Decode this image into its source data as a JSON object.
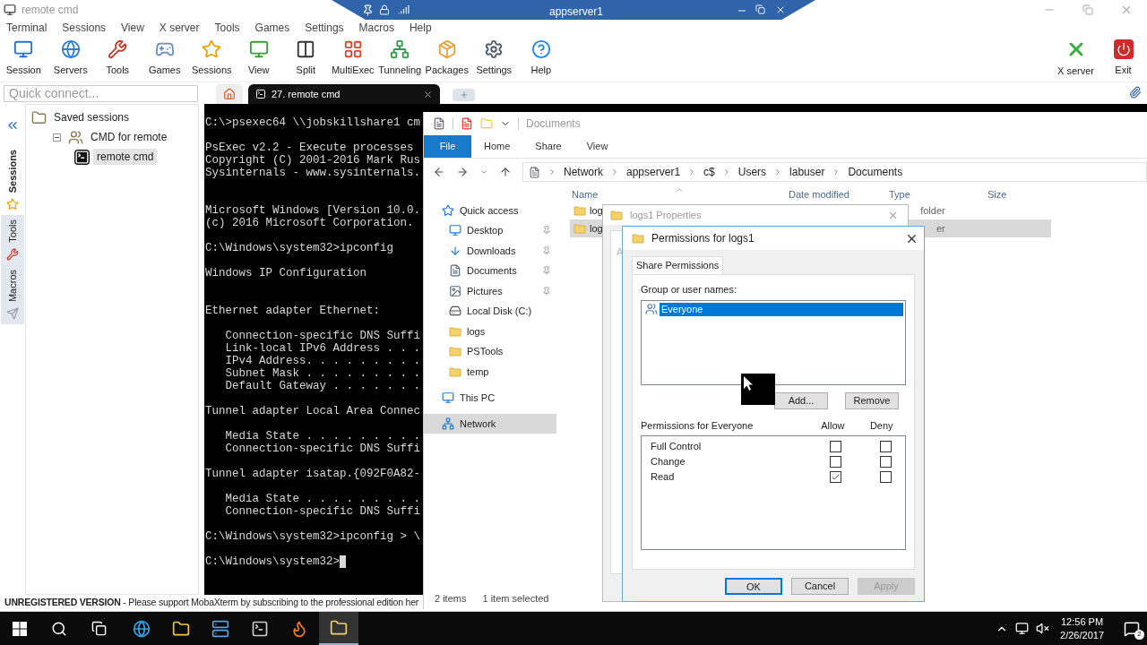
{
  "app": {
    "title": "remote cmd"
  },
  "remote_bar": {
    "title": "appserver1"
  },
  "menu": [
    "Terminal",
    "Sessions",
    "View",
    "X server",
    "Tools",
    "Games",
    "Settings",
    "Macros",
    "Help"
  ],
  "toolbar": [
    "Session",
    "Servers",
    "Tools",
    "Games",
    "Sessions",
    "View",
    "Split",
    "MultiExec",
    "Tunneling",
    "Packages",
    "Settings",
    "Help"
  ],
  "toolbar_right": [
    "X server",
    "Exit"
  ],
  "quick_connect": {
    "placeholder": "Quick connect..."
  },
  "tabs": [
    {
      "kind": "home",
      "selected": false
    },
    {
      "kind": "session",
      "label": "27. remote cmd",
      "selected": true
    },
    {
      "kind": "add",
      "selected": false
    }
  ],
  "side_tabs": [
    {
      "label": "Sessions",
      "selected": true
    },
    {
      "label": "Tools",
      "selected": false
    },
    {
      "label": "Macros",
      "selected": false
    }
  ],
  "session_tree": [
    {
      "label": "Saved sessions",
      "kind": "root",
      "selected": false,
      "children": [
        {
          "label": "CMD for remote",
          "kind": "folder",
          "expanded": true,
          "selected": false,
          "children": [
            {
              "label": "remote cmd",
              "kind": "session",
              "selected": true
            }
          ]
        }
      ]
    }
  ],
  "terminal": {
    "lines": [
      {
        "kind": "text",
        "text": "C:\\>psexec64 \\\\jobskillshare1 cm"
      },
      {
        "kind": "blank"
      },
      {
        "kind": "text",
        "text": "PsExec v2.2 - Execute processes"
      },
      {
        "kind": "text",
        "text": "Copyright (C) 2001-2016 Mark Rus"
      },
      {
        "kind": "text",
        "text": "Sysinternals - www.sysinternals."
      },
      {
        "kind": "blank"
      },
      {
        "kind": "blank"
      },
      {
        "kind": "text",
        "text": "Microsoft Windows [Version 10.0."
      },
      {
        "kind": "text",
        "text": "(c) 2016 Microsoft Corporation."
      },
      {
        "kind": "blank"
      },
      {
        "kind": "text",
        "text": "C:\\Windows\\system32>ipconfig"
      },
      {
        "kind": "blank"
      },
      {
        "kind": "text",
        "text": "Windows IP Configuration"
      },
      {
        "kind": "blank"
      },
      {
        "kind": "blank"
      },
      {
        "kind": "text",
        "text": "Ethernet adapter Ethernet:"
      },
      {
        "kind": "blank"
      },
      {
        "kind": "text",
        "text": "   Connection-specific DNS Suffi"
      },
      {
        "kind": "text",
        "text": "   Link-local IPv6 Address . . ."
      },
      {
        "kind": "text",
        "text": "   IPv4 Address. . . . . . . . ."
      },
      {
        "kind": "text",
        "text": "   Subnet Mask . . . . . . . . ."
      },
      {
        "kind": "text",
        "text": "   Default Gateway . . . . . . ."
      },
      {
        "kind": "blank"
      },
      {
        "kind": "text",
        "text": "Tunnel adapter Local Area Connec"
      },
      {
        "kind": "blank"
      },
      {
        "kind": "text",
        "text": "   Media State . . . . . . . . ."
      },
      {
        "kind": "text",
        "text": "   Connection-specific DNS Suffi"
      },
      {
        "kind": "blank"
      },
      {
        "kind": "text",
        "text": "Tunnel adapter isatap.{092F0A82-"
      },
      {
        "kind": "blank"
      },
      {
        "kind": "text",
        "text": "   Media State . . . . . . . . ."
      },
      {
        "kind": "text",
        "text": "   Connection-specific DNS Suffi"
      },
      {
        "kind": "blank"
      },
      {
        "kind": "text",
        "text": "C:\\Windows\\system32>ipconfig > \\"
      },
      {
        "kind": "blank"
      },
      {
        "kind": "prompt",
        "text": "C:\\Windows\\system32>",
        "cursor": true
      }
    ]
  },
  "status_bar": {
    "text": "**UNREGISTERED VERSION**  -  Please support MobaXterm by subscribing to the professional edition her"
  },
  "explorer": {
    "title": "Documents",
    "ribbon_tabs": [
      {
        "label": "File",
        "selected": true
      },
      {
        "label": "Home",
        "selected": false
      },
      {
        "label": "Share",
        "selected": false
      },
      {
        "label": "View",
        "selected": false
      }
    ],
    "breadcrumbs": [
      "Network",
      "appserver1",
      "c$",
      "Users",
      "labuser",
      "Documents"
    ],
    "nav": [
      {
        "label": "Quick access",
        "selected": false,
        "children": [
          {
            "label": "Desktop",
            "pinned": true,
            "selected": false
          },
          {
            "label": "Downloads",
            "pinned": true,
            "selected": false
          },
          {
            "label": "Documents",
            "pinned": true,
            "selected": false
          },
          {
            "label": "Pictures",
            "pinned": true,
            "selected": false
          },
          {
            "label": "Local Disk (C:)",
            "pinned": false,
            "selected": false
          },
          {
            "label": "logs",
            "pinned": false,
            "selected": false
          },
          {
            "label": "PSTools",
            "pinned": false,
            "selected": false
          },
          {
            "label": "temp",
            "pinned": false,
            "selected": false
          }
        ]
      },
      {
        "label": "This PC",
        "selected": false
      },
      {
        "label": "Network",
        "selected": true
      }
    ],
    "columns": [
      "Name",
      "Date modified",
      "Type",
      "Size"
    ],
    "rows": [
      {
        "name": "log",
        "type": "folder",
        "selected": false
      },
      {
        "name": "log",
        "type": "er",
        "selected": true
      }
    ],
    "status": [
      "2 items",
      "1 item selected"
    ]
  },
  "properties_dialog": {
    "title": "logs1 Properties",
    "tab_fragment": "A"
  },
  "permissions_dialog": {
    "title": "Permissions for logs1",
    "tabs": [
      {
        "label": "Share Permissions",
        "selected": true
      }
    ],
    "group_label": "Group or user names:",
    "users": [
      {
        "name": "Everyone",
        "selected": true
      }
    ],
    "user_buttons": [
      "Add...",
      "Remove"
    ],
    "permissions_label": "Permissions for Everyone",
    "permission_columns": [
      "Allow",
      "Deny"
    ],
    "permissions": [
      {
        "label": "Full Control",
        "allow": false,
        "deny": false
      },
      {
        "label": "Change",
        "allow": false,
        "deny": false
      },
      {
        "label": "Read",
        "allow": true,
        "deny": false
      }
    ],
    "buttons": [
      {
        "label": "OK",
        "default": true,
        "disabled": false
      },
      {
        "label": "Cancel",
        "default": false,
        "disabled": false
      },
      {
        "label": "Apply",
        "default": false,
        "disabled": true
      }
    ]
  },
  "taskbar": {
    "apps": [
      {
        "selected": false
      },
      {
        "selected": false
      },
      {
        "selected": false
      },
      {
        "selected": false
      },
      {
        "selected": false
      },
      {
        "selected": false
      },
      {
        "selected": false
      },
      {
        "selected": false
      },
      {
        "selected": true
      }
    ],
    "time": "12:56 PM",
    "date": "2/26/2017",
    "notifications": "2"
  }
}
